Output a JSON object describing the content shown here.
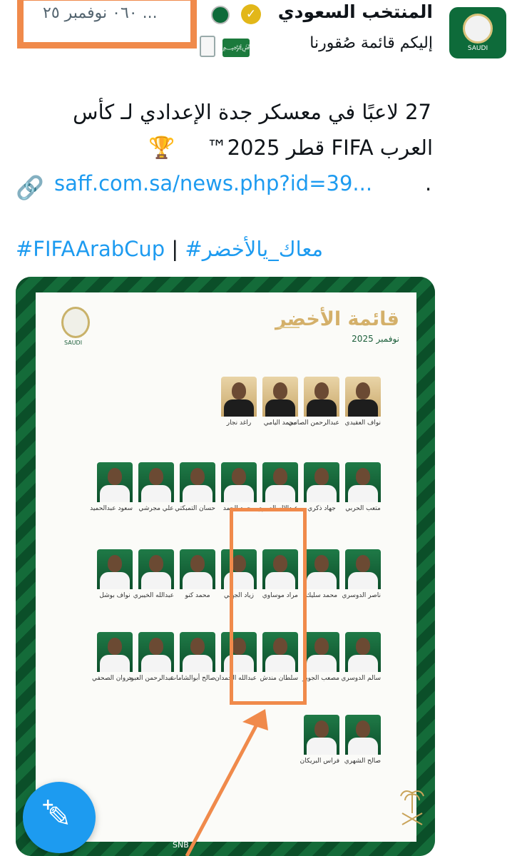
{
  "tweet": {
    "author_name": "المنتخب السعودي",
    "timestamp": "... ٠٦٠ نوفمبر ٢٥",
    "subtitle": "إليكم قائمة صُقورنا",
    "body_line1": "27 لاعبًا في معسكر جدة الإعدادي لـ كأس",
    "body_line2": "العرب FIFA قطر 2025™",
    "link": "saff.com.sa/news.php?id=39...",
    "link_suffix": ".",
    "hashtag_1": "#معاك_يالأخضر",
    "hashtag_sep": "|",
    "hashtag_2": "#FIFAArabCup"
  },
  "icons": {
    "verified": "verified-badge-icon",
    "affiliate": "federation-badge-icon",
    "flag": "saudi-flag-icon",
    "clipboard": "clipboard-icon",
    "trophy": "trophy-icon",
    "link": "link-icon",
    "compose": "compose-icon"
  },
  "media": {
    "logo_label": "SAUDI",
    "avatar_label": "SAUDI",
    "title": "قائمة الأخضر",
    "date": "نوفمبر 2025",
    "sponsors": "SNB",
    "players": [
      {
        "name": "نواف العقيدي",
        "kind": "gk"
      },
      {
        "name": "عبدالرحمن الصانبي",
        "kind": "gk"
      },
      {
        "name": "محمد اليامي",
        "kind": "gk"
      },
      {
        "name": "راغد نجار",
        "kind": "gk"
      },
      {
        "name": "متعب الحربي",
        "kind": "field"
      },
      {
        "name": "جهاد ذكري",
        "kind": "field"
      },
      {
        "name": "عبدالإله العمري",
        "kind": "field"
      },
      {
        "name": "محمد الحمد",
        "kind": "field"
      },
      {
        "name": "حسان التمبكتي",
        "kind": "field"
      },
      {
        "name": "علي مجرشي",
        "kind": "field"
      },
      {
        "name": "سعود عبدالحميد",
        "kind": "field"
      },
      {
        "name": "ناصر الدوسري",
        "kind": "field"
      },
      {
        "name": "محمد سليك",
        "kind": "field"
      },
      {
        "name": "مراد موساوي",
        "kind": "field"
      },
      {
        "name": "زياد الجهني",
        "kind": "field"
      },
      {
        "name": "محمد كنو",
        "kind": "field"
      },
      {
        "name": "عبدالله الخيبري",
        "kind": "field"
      },
      {
        "name": "نواف بوشل",
        "kind": "field"
      },
      {
        "name": "سالم الدوسري",
        "kind": "field"
      },
      {
        "name": "مصعب الجوير",
        "kind": "field"
      },
      {
        "name": "سلطان مندش",
        "kind": "field"
      },
      {
        "name": "عبدالله الحمدان",
        "kind": "field"
      },
      {
        "name": "صالح أبوالشامات",
        "kind": "field"
      },
      {
        "name": "عبدالرحمن العبود",
        "kind": "field"
      },
      {
        "name": "مروان الصحفي",
        "kind": "field"
      },
      {
        "name": "صالح الشهري",
        "kind": "field"
      },
      {
        "name": "فراس البريكان",
        "kind": "field"
      }
    ]
  },
  "colors": {
    "accent_blue": "#1d9bf0",
    "highlight_orange": "#f08a4b",
    "saudi_green": "#0e6b3a",
    "gold": "#d4b06a"
  }
}
